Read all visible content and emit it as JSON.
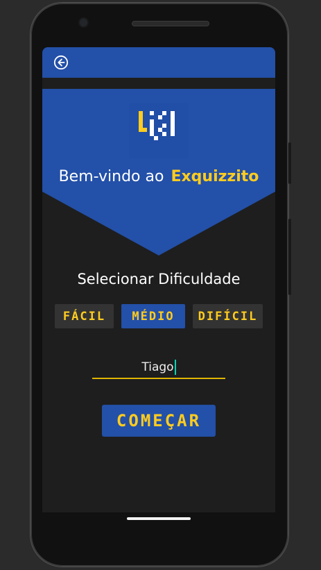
{
  "header": {
    "back_icon": "arrow-left-circle-icon"
  },
  "banner": {
    "logo_icon": "exquizzito-logo",
    "welcome_text": "Bem-vindo ao",
    "brand_name": "Exquizzito"
  },
  "difficulty": {
    "title": "Selecionar Dificuldade",
    "options": [
      {
        "label": "FÁCIL",
        "selected": false
      },
      {
        "label": "MÉDIO",
        "selected": true
      },
      {
        "label": "DIFÍCIL",
        "selected": false
      }
    ]
  },
  "player": {
    "name_value": "Tiago"
  },
  "actions": {
    "start_label": "COMEÇAR"
  },
  "colors": {
    "primary_blue": "#2350a8",
    "accent_yellow": "#ffcc1f",
    "background": "#1e1e1e",
    "inactive_button": "#333333"
  }
}
